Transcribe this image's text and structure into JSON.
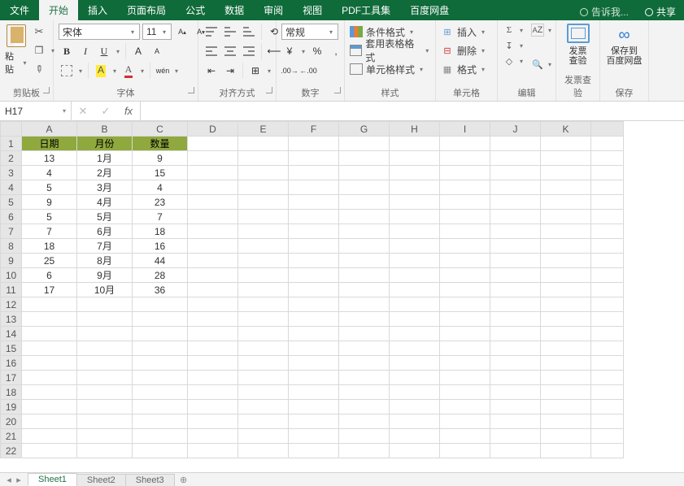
{
  "menubar": {
    "tabs": [
      "文件",
      "开始",
      "插入",
      "页面布局",
      "公式",
      "数据",
      "审阅",
      "视图",
      "PDF工具集",
      "百度网盘"
    ],
    "active_index": 1,
    "hint": "告诉我...",
    "share": "共享"
  },
  "ribbon": {
    "clipboard": {
      "paste": "粘贴",
      "label": "剪贴板"
    },
    "font": {
      "name": "宋体",
      "size": "11",
      "label": "字体",
      "bold": "B",
      "italic": "I",
      "underline": "U",
      "increase": "A",
      "decrease": "A",
      "wen": "wén"
    },
    "alignment": {
      "label": "对齐方式"
    },
    "number": {
      "format": "常规",
      "label": "数字"
    },
    "styles": {
      "cond": "条件格式",
      "table": "套用表格格式",
      "cell": "单元格样式",
      "label": "样式"
    },
    "cells": {
      "insert": "插入",
      "delete": "删除",
      "format": "格式",
      "label": "单元格"
    },
    "editing": {
      "label": "编辑"
    },
    "fapiao": {
      "btn": "发票\n查验",
      "label": "发票查验"
    },
    "save": {
      "btn": "保存到\n百度网盘",
      "label": "保存"
    }
  },
  "namebox": "H17",
  "formula": "",
  "columns": [
    "A",
    "B",
    "C",
    "D",
    "E",
    "F",
    "G",
    "H",
    "I",
    "J",
    "K"
  ],
  "col_widths": [
    "colA",
    "colB",
    "colC",
    "colW",
    "colW",
    "colW",
    "colW",
    "colW",
    "colW",
    "colW",
    "colW",
    "colL"
  ],
  "headers": [
    "日期",
    "月份",
    "数量"
  ],
  "data_rows": [
    [
      "13",
      "1月",
      "9"
    ],
    [
      "4",
      "2月",
      "15"
    ],
    [
      "5",
      "3月",
      "4"
    ],
    [
      "9",
      "4月",
      "23"
    ],
    [
      "5",
      "5月",
      "7"
    ],
    [
      "7",
      "6月",
      "18"
    ],
    [
      "18",
      "7月",
      "16"
    ],
    [
      "25",
      "8月",
      "44"
    ],
    [
      "6",
      "9月",
      "28"
    ],
    [
      "17",
      "10月",
      "36"
    ]
  ],
  "total_rows": 22,
  "sheets": [
    "Sheet1",
    "Sheet2",
    "Sheet3"
  ],
  "active_sheet": 0
}
